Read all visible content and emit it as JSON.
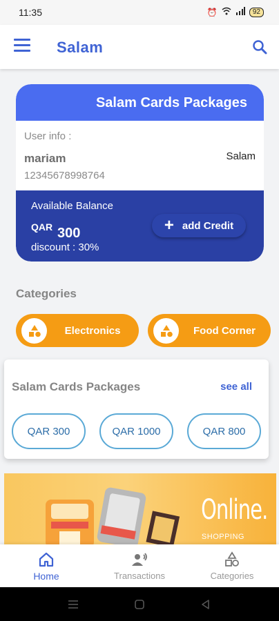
{
  "status_bar": {
    "time": "11:35",
    "icons": [
      "alarm-icon",
      "wifi-icon",
      "signal-icon"
    ],
    "battery": "92"
  },
  "app_bar": {
    "title": "Salam",
    "menu_icon": "menu-icon",
    "search_icon": "search-icon"
  },
  "account_card": {
    "header_title": "Salam Cards Packages",
    "user_info_label": "User info :",
    "user_name": "mariam",
    "user_tag": "Salam",
    "user_phone": "12345678998764",
    "balance": {
      "label": "Available Balance",
      "currency": "QAR",
      "amount": "300",
      "discount": "discount : 30%",
      "add_credit_label": "add Credit"
    }
  },
  "categories": {
    "title": "Categories",
    "items": [
      {
        "label": "Electronics",
        "icon": "shapes-icon"
      },
      {
        "label": "Food Corner",
        "icon": "shapes-icon"
      }
    ]
  },
  "packages": {
    "title": "Salam Cards Packages",
    "see_all": "see all",
    "items": [
      {
        "label": "QAR 300"
      },
      {
        "label": "QAR 1000"
      },
      {
        "label": "QAR 800"
      }
    ]
  },
  "banner": {
    "text": "Online.",
    "subtext": "SHOPPING"
  },
  "bottom_nav": {
    "items": [
      {
        "label": "Home",
        "icon": "home-icon",
        "active": true
      },
      {
        "label": "Transactions",
        "icon": "transactions-icon",
        "active": false
      },
      {
        "label": "Categories",
        "icon": "categories-icon",
        "active": false
      }
    ]
  },
  "colors": {
    "primary": "#3f63d4",
    "header_blue": "#4a6cf0",
    "balance_navy": "#2a40a4",
    "category_orange": "#f59c14",
    "package_border": "#5aa9d6"
  }
}
